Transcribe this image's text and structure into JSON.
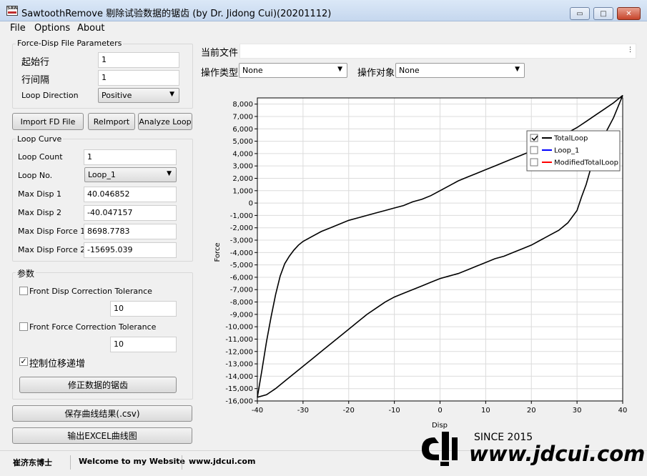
{
  "window": {
    "icon_text": "SAW",
    "title": "SawtoothRemove 剔除试验数据的锯齿 (by Dr. Jidong Cui)(20201112)",
    "min_glyph": "▭",
    "max_glyph": "□",
    "close_glyph": "✕"
  },
  "menu": [
    "File",
    "Options",
    "About"
  ],
  "fd_params": {
    "title": "Force-Disp File Parameters",
    "start_row_label": "起始行",
    "start_row_value": "1",
    "row_interval_label": "行间隔",
    "row_interval_value": "1",
    "loop_direction_label": "Loop Direction",
    "loop_direction_value": "Positive"
  },
  "buttons": {
    "import": "Import FD File",
    "reimport": "ReImport",
    "analyze": "Analyze Loop",
    "fix": "修正数据的锯齿",
    "save_csv": "保存曲线结果(.csv)",
    "export_excel": "输出EXCEL曲线图"
  },
  "loop_curve": {
    "title": "Loop Curve",
    "fields": [
      {
        "label": "Loop Count",
        "value": "1"
      },
      {
        "label": "Loop No.",
        "value": "Loop_1"
      },
      {
        "label": "Max Disp 1",
        "value": "40.046852"
      },
      {
        "label": "Max Disp 2",
        "value": "-40.047157"
      },
      {
        "label": "Max Disp Force 1",
        "value": "8698.7783"
      },
      {
        "label": "Max Disp Force 2",
        "value": "-15695.039"
      }
    ]
  },
  "params": {
    "title": "参数",
    "front_disp_label": "Front Disp Correction Tolerance",
    "front_disp_checked": false,
    "front_disp_value": "10",
    "front_force_label": "Front Force Correction Tolerance",
    "front_force_checked": false,
    "front_force_value": "10",
    "ctrl_label": "控制位移递增",
    "ctrl_checked": true
  },
  "right_panel": {
    "current_file_label": "当前文件",
    "current_file_value": "",
    "op_type_label": "操作类型",
    "op_type_value": "None",
    "op_target_label": "操作对象",
    "op_target_value": "None"
  },
  "status": {
    "author": "崔济东博士",
    "welcome": "Welcome to my Website",
    "url": "www.jdcui.com"
  },
  "watermark": {
    "since": "SINCE 2015",
    "site": "www.jdcui.com"
  },
  "chart_data": {
    "type": "line",
    "xlabel": "Disp",
    "ylabel": "Force",
    "xlim": [
      -40,
      40
    ],
    "ylim": [
      -16000,
      8500
    ],
    "x_ticks": [
      -40,
      -30,
      -20,
      -10,
      0,
      10,
      20,
      30,
      40
    ],
    "y_ticks": [
      8000,
      7000,
      6000,
      5000,
      4000,
      3000,
      2000,
      1000,
      0,
      -1000,
      -2000,
      -3000,
      -4000,
      -5000,
      -6000,
      -7000,
      -8000,
      -9000,
      -10000,
      -11000,
      -12000,
      -13000,
      -14000,
      -15000,
      -16000
    ],
    "grid": true,
    "legend_position": "top-right",
    "legend": [
      {
        "name": "TotalLoop",
        "color": "#000000",
        "checked": true
      },
      {
        "name": "Loop_1",
        "color": "#0000ff",
        "checked": false
      },
      {
        "name": "ModifiedTotalLoop",
        "color": "#ff0000",
        "checked": false
      }
    ],
    "series": [
      {
        "name": "TotalLoop",
        "color": "#000000",
        "x": [
          -40,
          -39,
          -38,
          -37,
          -36,
          -35,
          -34,
          -33,
          -32,
          -31,
          -30,
          -28,
          -26,
          -24,
          -22,
          -20,
          -18,
          -16,
          -14,
          -12,
          -10,
          -8,
          -6,
          -4,
          -2,
          0,
          2,
          4,
          6,
          8,
          10,
          12,
          14,
          16,
          18,
          20,
          22,
          24,
          26,
          28,
          30,
          32,
          34,
          36,
          38,
          40,
          38,
          36,
          34,
          33,
          32,
          31,
          30,
          28,
          26,
          24,
          22,
          20,
          18,
          16,
          14,
          12,
          10,
          8,
          6,
          4,
          2,
          0,
          -2,
          -4,
          -6,
          -8,
          -10,
          -12,
          -14,
          -16,
          -18,
          -20,
          -22,
          -24,
          -26,
          -28,
          -30,
          -32,
          -34,
          -36,
          -38,
          -40
        ],
        "y": [
          -15700,
          -13500,
          -11200,
          -9200,
          -7400,
          -5900,
          -4900,
          -4300,
          -3800,
          -3400,
          -3100,
          -2700,
          -2300,
          -2000,
          -1700,
          -1400,
          -1200,
          -1000,
          -800,
          -600,
          -400,
          -200,
          100,
          300,
          600,
          1000,
          1400,
          1800,
          2100,
          2400,
          2700,
          3000,
          3300,
          3600,
          3900,
          4200,
          4500,
          4900,
          5300,
          5700,
          6100,
          6600,
          7100,
          7600,
          8100,
          8700,
          6900,
          5500,
          4000,
          2800,
          1500,
          500,
          -600,
          -1600,
          -2200,
          -2600,
          -3000,
          -3400,
          -3700,
          -4000,
          -4300,
          -4500,
          -4800,
          -5100,
          -5400,
          -5700,
          -5900,
          -6100,
          -6400,
          -6700,
          -7000,
          -7300,
          -7600,
          -8000,
          -8500,
          -9000,
          -9600,
          -10200,
          -10800,
          -11400,
          -12000,
          -12600,
          -13200,
          -13800,
          -14400,
          -15000,
          -15500,
          -15700
        ]
      }
    ]
  }
}
